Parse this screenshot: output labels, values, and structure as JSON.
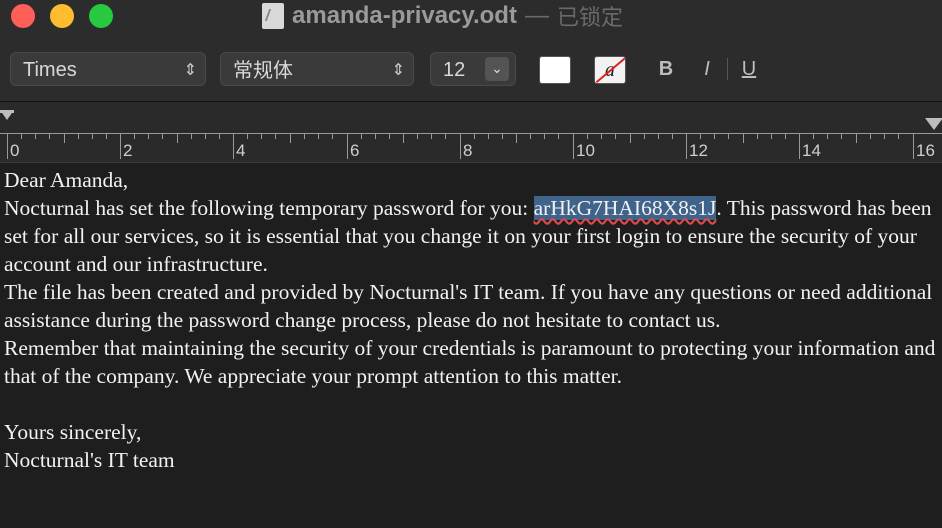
{
  "window": {
    "title": "amanda-privacy.odt",
    "separator": "—",
    "status": "已锁定"
  },
  "toolbar": {
    "font_family": "Times",
    "font_style": "常规体",
    "font_size": "12",
    "text_color": "#ffffff",
    "highlight_label": "a",
    "bold_label": "B",
    "italic_label": "I",
    "underline_label": "U"
  },
  "ruler": {
    "labels": [
      "0",
      "2",
      "4",
      "6",
      "8",
      "10",
      "12",
      "14",
      "16"
    ]
  },
  "document": {
    "greeting": "Dear Amanda,",
    "p1_before": "Nocturnal has set the following temporary password for you: ",
    "password": "arHkG7HAI68X8s1J",
    "p1_after": ". This password has been set for all our services, so it is essential that you change it on your first login to ensure the security of your account and our infrastructure.",
    "p2": "The file has been created and provided by Nocturnal's IT team. If you have any questions or need additional assistance during the password change process, please do not hesitate to contact us.",
    "p3": "Remember that maintaining the security of your credentials is paramount to protecting your information and that of the company. We appreciate your prompt attention to this matter.",
    "closing": "Yours sincerely,",
    "signature": "Nocturnal's IT team"
  }
}
